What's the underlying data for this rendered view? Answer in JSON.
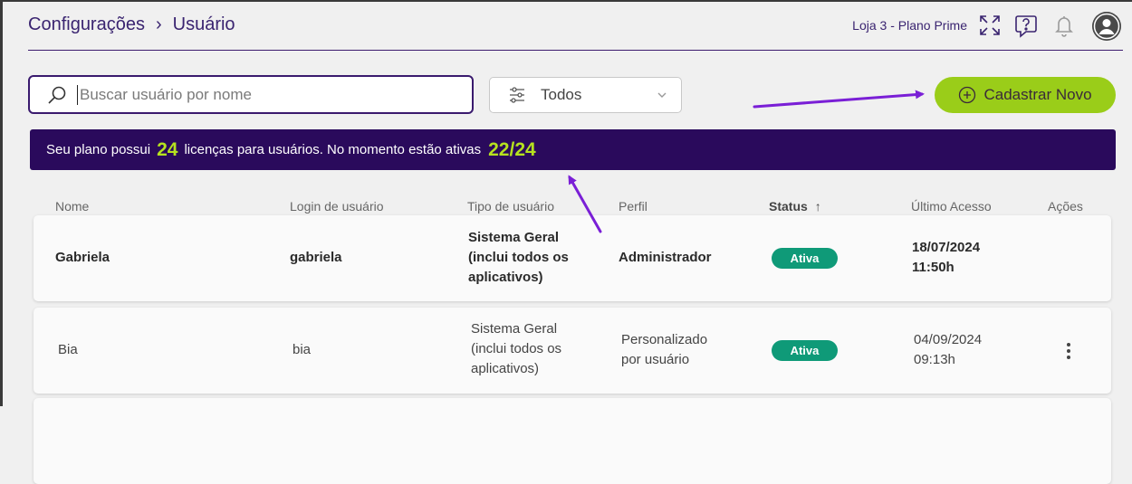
{
  "header": {
    "breadcrumb": [
      "Configurações",
      "Usuário"
    ],
    "store_plan": "Loja 3 - Plano Prime"
  },
  "search": {
    "placeholder": "Buscar usuário por nome",
    "value": ""
  },
  "filter": {
    "selected": "Todos"
  },
  "new_button": {
    "label": "Cadastrar Novo"
  },
  "banner": {
    "text_before": "Seu plano possui",
    "licenses": "24",
    "text_middle": "licenças para usuários. No momento estão ativas",
    "active": "22/24"
  },
  "table": {
    "columns": {
      "name": "Nome",
      "login": "Login de usuário",
      "type": "Tipo de usuário",
      "profile": "Perfil",
      "status": "Status",
      "last_access": "Último Acesso",
      "actions": "Ações"
    },
    "rows": [
      {
        "name": "Gabriela",
        "login": "gabriela",
        "type_line1": "Sistema Geral",
        "type_line2": "(inclui todos os",
        "type_line3": "aplicativos)",
        "profile_line1": "Administrador",
        "profile_line2": "",
        "status": "Ativa",
        "last_date": "18/07/2024",
        "last_time": "11:50h"
      },
      {
        "name": "Bia",
        "login": "bia",
        "type_line1": "Sistema Geral",
        "type_line2": "(inclui todos os",
        "type_line3": "aplicativos)",
        "profile_line1": "Personalizado",
        "profile_line2": "por usuário",
        "status": "Ativa",
        "last_date": "04/09/2024",
        "last_time": "09:13h"
      }
    ]
  },
  "colors": {
    "primary_purple": "#2a0a5c",
    "accent_green": "#9acd19",
    "highlight_green": "#b6e21f",
    "status_green": "#0f9a78",
    "annotation_arrow": "#7a1fd6"
  },
  "icons": [
    "search-icon",
    "filter-sliders-icon",
    "chevron-down-icon",
    "plus-circle-icon",
    "expand-icon",
    "help-chat-icon",
    "bell-icon",
    "user-avatar-icon",
    "kebab-menu-icon",
    "sort-arrow-up-icon"
  ]
}
